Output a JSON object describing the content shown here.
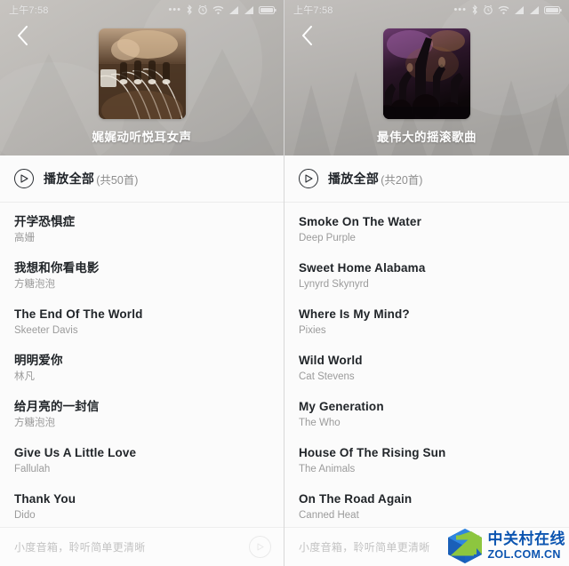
{
  "statusbar": {
    "time": "上午7:58",
    "icons": [
      "more-dots-icon",
      "bluetooth-icon",
      "alarm-clock-icon",
      "wifi-icon",
      "signal-bars-icon",
      "signal-bars-2-icon",
      "battery-icon"
    ]
  },
  "screens": [
    {
      "id": "left",
      "back_icon": "back-chevron-icon",
      "cover_alt": "guzheng-strings-photo",
      "playlist_title": "娓娓动听悦耳女声",
      "play_all": {
        "icon": "play-circle-icon",
        "label": "播放全部",
        "count": "(共50首)"
      },
      "songs": [
        {
          "title": "开学恐惧症",
          "artist": "高姗"
        },
        {
          "title": "我想和你看电影",
          "artist": "方糖泡泡"
        },
        {
          "title": "The End Of The World",
          "artist": "Skeeter Davis"
        },
        {
          "title": "明明爱你",
          "artist": "林凡"
        },
        {
          "title": "给月亮的一封信",
          "artist": "方糖泡泡"
        },
        {
          "title": "Give Us A Little Love",
          "artist": "Fallulah"
        },
        {
          "title": "Thank You",
          "artist": "Dido"
        }
      ],
      "bottom": {
        "text": "小度音箱，聆听简单更清晰",
        "play_icon": "play-circle-icon"
      }
    },
    {
      "id": "right",
      "back_icon": "back-chevron-icon",
      "cover_alt": "concert-crowd-hands-photo",
      "playlist_title": "最伟大的摇滚歌曲",
      "play_all": {
        "icon": "play-circle-icon",
        "label": "播放全部",
        "count": "(共20首)"
      },
      "songs": [
        {
          "title": "Smoke On The Water",
          "artist": "Deep Purple"
        },
        {
          "title": "Sweet Home Alabama",
          "artist": "Lynyrd Skynyrd"
        },
        {
          "title": "Where Is My Mind?",
          "artist": "Pixies"
        },
        {
          "title": "Wild World",
          "artist": "Cat Stevens"
        },
        {
          "title": "My Generation",
          "artist": "The Who"
        },
        {
          "title": "House Of The Rising Sun",
          "artist": "The Animals"
        },
        {
          "title": "On The Road Again",
          "artist": "Canned Heat"
        }
      ],
      "bottom": {
        "text": "小度音箱，聆听简单更清晰",
        "play_icon": "play-circle-icon"
      }
    }
  ],
  "watermark": {
    "logo_icon": "zol-diamond-logo-icon",
    "cn_text": "中关村在线",
    "en_text": "ZOL.COM.CN",
    "color": "#0b54b0"
  },
  "colors": {
    "header_bg": "#b3b1ae",
    "body_bg": "#fbfbfb",
    "title_text": "#212529",
    "artist_text": "#9b9b9b",
    "bottom_text": "#c3c3c3"
  }
}
